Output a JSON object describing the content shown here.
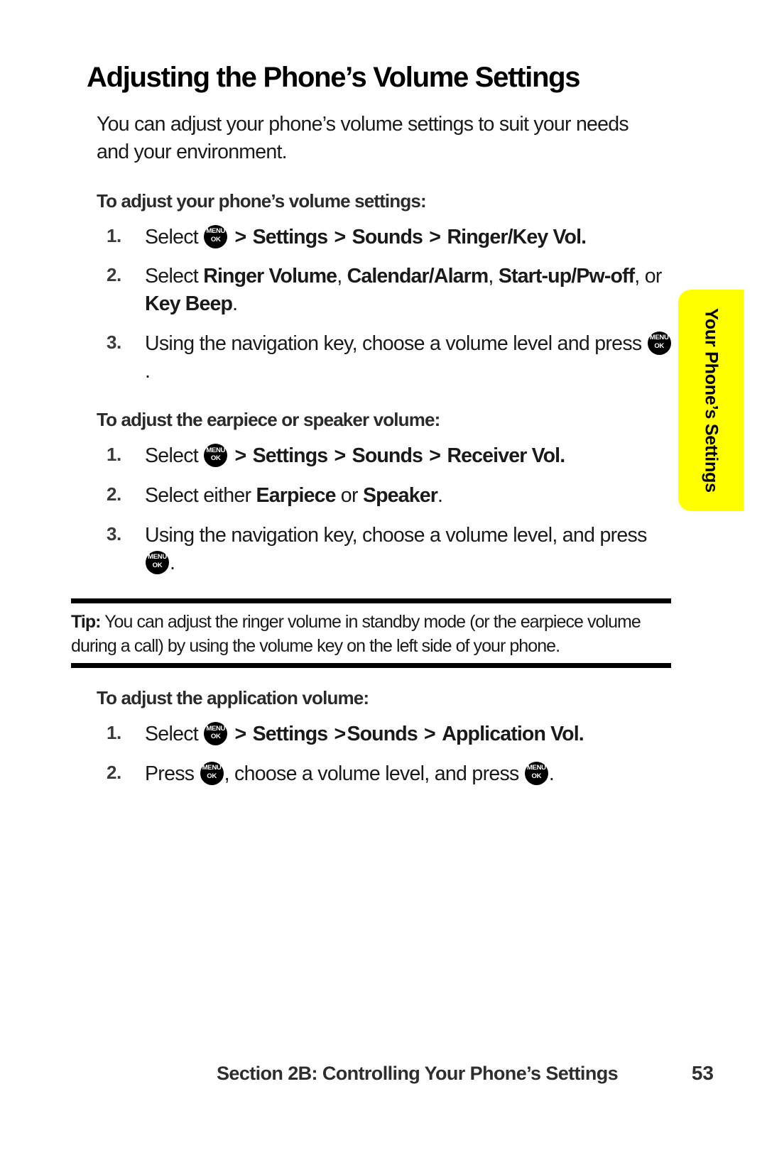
{
  "page": {
    "title": "Adjusting the Phone’s Volume Settings",
    "intro": "You can adjust your phone’s volume settings to suit your needs and your environment."
  },
  "side_tab": {
    "label": "Your Phone’s Settings",
    "color": "#FFFF00"
  },
  "icons": {
    "menu_ok": {
      "name": "menu-ok-key-icon",
      "top": "MENU",
      "bottom": "OK"
    }
  },
  "sections": [
    {
      "heading": "To adjust your phone’s volume settings:",
      "steps": [
        {
          "number": "1.",
          "parts": [
            {
              "t": "text",
              "v": "Select "
            },
            {
              "t": "icon",
              "v": "menu-ok"
            },
            {
              "t": "chev",
              "v": " > "
            },
            {
              "t": "bold",
              "v": "Settings"
            },
            {
              "t": "chev",
              "v": " > "
            },
            {
              "t": "bold",
              "v": "Sounds"
            },
            {
              "t": "chev",
              "v": " > "
            },
            {
              "t": "bold",
              "v": "Ringer/Key Vol."
            }
          ]
        },
        {
          "number": "2.",
          "parts": [
            {
              "t": "text",
              "v": "Select "
            },
            {
              "t": "bold",
              "v": "Ringer Volume"
            },
            {
              "t": "text",
              "v": ", "
            },
            {
              "t": "bold",
              "v": "Calendar/Alarm"
            },
            {
              "t": "text",
              "v": ", "
            },
            {
              "t": "bold",
              "v": "Start-up/Pw-off"
            },
            {
              "t": "text",
              "v": ", or "
            },
            {
              "t": "bold",
              "v": "Key Beep"
            },
            {
              "t": "text",
              "v": "."
            }
          ]
        },
        {
          "number": "3.",
          "parts": [
            {
              "t": "text",
              "v": "Using the navigation key, choose a volume level and press "
            },
            {
              "t": "icon",
              "v": "menu-ok"
            },
            {
              "t": "text",
              "v": "."
            }
          ]
        }
      ]
    },
    {
      "heading": "To adjust the earpiece or speaker volume:",
      "steps": [
        {
          "number": "1.",
          "parts": [
            {
              "t": "text",
              "v": "Select "
            },
            {
              "t": "icon",
              "v": "menu-ok"
            },
            {
              "t": "chev",
              "v": " > "
            },
            {
              "t": "bold",
              "v": "Settings"
            },
            {
              "t": "chev",
              "v": " > "
            },
            {
              "t": "bold",
              "v": "Sounds"
            },
            {
              "t": "chev",
              "v": " > "
            },
            {
              "t": "bold",
              "v": "Receiver Vol."
            }
          ]
        },
        {
          "number": "2.",
          "parts": [
            {
              "t": "text",
              "v": "Select either "
            },
            {
              "t": "bold",
              "v": "Earpiece"
            },
            {
              "t": "text",
              "v": " or "
            },
            {
              "t": "bold",
              "v": "Speaker"
            },
            {
              "t": "text",
              "v": "."
            }
          ]
        },
        {
          "number": "3.",
          "parts": [
            {
              "t": "text",
              "v": "Using the navigation key, choose a volume level, and press "
            },
            {
              "t": "icon",
              "v": "menu-ok"
            },
            {
              "t": "text",
              "v": "."
            }
          ]
        }
      ]
    }
  ],
  "tip": {
    "label": "Tip:",
    "text": " You can adjust the ringer volume in standby mode (or the earpiece volume during a call) by using the volume key on the left side of your phone."
  },
  "section_after_tip": {
    "heading": "To adjust the application volume:",
    "steps": [
      {
        "number": "1.",
        "parts": [
          {
            "t": "text",
            "v": "Select "
          },
          {
            "t": "icon",
            "v": "menu-ok"
          },
          {
            "t": "chev",
            "v": " > "
          },
          {
            "t": "bold",
            "v": "Settings"
          },
          {
            "t": "chev",
            "v": " >"
          },
          {
            "t": "bold",
            "v": "Sounds"
          },
          {
            "t": "chev",
            "v": " > "
          },
          {
            "t": "bold",
            "v": "Application Vol."
          }
        ]
      },
      {
        "number": "2.",
        "parts": [
          {
            "t": "text",
            "v": "Press "
          },
          {
            "t": "icon",
            "v": "menu-ok"
          },
          {
            "t": "text",
            "v": ", choose a volume level, and press "
          },
          {
            "t": "icon",
            "v": "menu-ok"
          },
          {
            "t": "text",
            "v": "."
          }
        ]
      }
    ]
  },
  "footer": {
    "text": "Section 2B: Controlling Your Phone’s Settings",
    "page_number": "53"
  }
}
